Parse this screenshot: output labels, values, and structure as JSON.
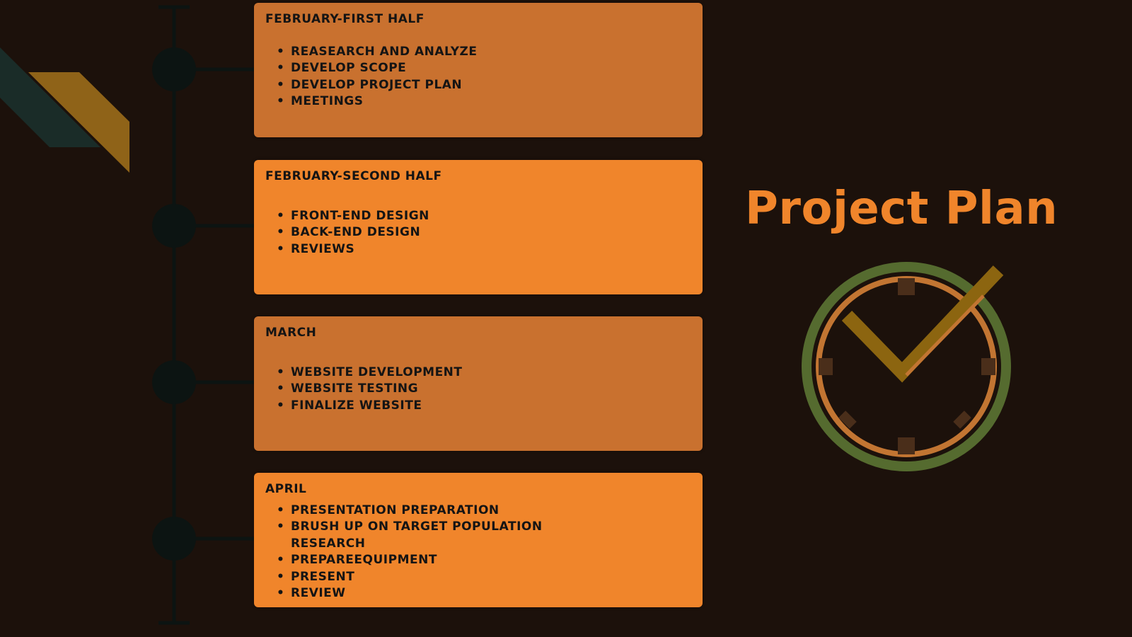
{
  "title": "Project Plan",
  "colors": {
    "background": "#1c110b",
    "accent_orange": "#f0852b",
    "card_dark": "#c9712f",
    "timeline": "#0c1412",
    "stripe_green": "#1a2c28",
    "stripe_gold": "#8f6318",
    "clock_ring": "#556b2f",
    "check_mark": "#8c6510"
  },
  "icons": {
    "clock": "clock-check-icon",
    "decoration": "diagonal-stripes-icon"
  },
  "phases": [
    {
      "heading": "February-First Half",
      "items": [
        "Reasearch and analyze",
        "Develop scope",
        "Develop project plan",
        "Meetings"
      ]
    },
    {
      "heading": "February-Second Half",
      "items": [
        "Front-End Design",
        "Back-End Design",
        "Reviews"
      ]
    },
    {
      "heading": "March",
      "items": [
        "Website Development",
        "Website testing",
        "Finalize website"
      ]
    },
    {
      "heading": "April",
      "items": [
        "Presentation preparation",
        "Brush up on target population research",
        "PrepareEquipment",
        "Present",
        "Review"
      ]
    }
  ]
}
